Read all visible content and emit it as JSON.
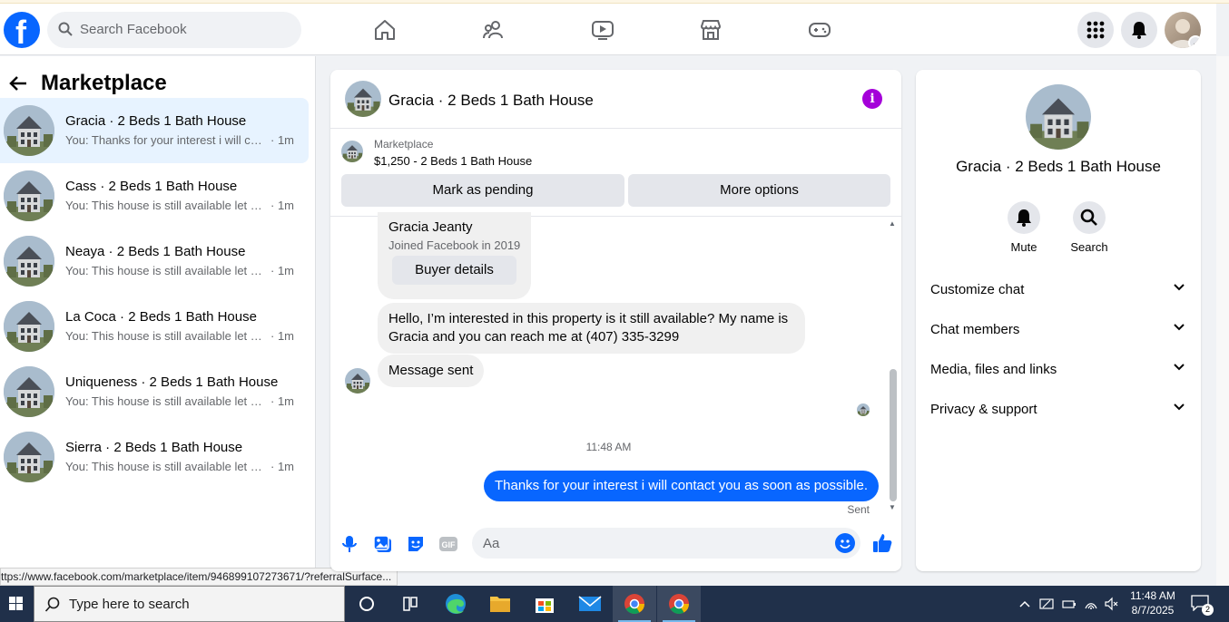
{
  "header": {
    "search_placeholder": "Search Facebook",
    "brand_color": "#0866ff",
    "nav_icons": [
      "home-icon",
      "friends-icon",
      "watch-icon",
      "marketplace-icon",
      "gaming-icon"
    ],
    "right_icons": [
      "menu-grid-icon",
      "notifications-bell-icon",
      "account-avatar"
    ]
  },
  "sidebar": {
    "title": "Marketplace",
    "conversations": [
      {
        "name": "Gracia · 2 Beds 1 Bath House",
        "preview": "You: Thanks for your interest i will contact you as soon as possible.",
        "time": "· 1m",
        "active": true
      },
      {
        "name": "Cass · 2 Beds 1 Bath House",
        "preview": "You: This house is still available let me know",
        "time": "· 1m"
      },
      {
        "name": "Neaya · 2 Beds 1 Bath House",
        "preview": "You: This house is still available let me know",
        "time": "· 1m"
      },
      {
        "name": "La Coca · 2 Beds 1 Bath House",
        "preview": "You: This house is still available let me know",
        "time": "· 1m"
      },
      {
        "name": "Uniqueness · 2 Beds 1 Bath House",
        "preview": "You: This house is still available let me know",
        "time": "· 1m"
      },
      {
        "name": "Sierra · 2 Beds 1 Bath House",
        "preview": "You: This house is still available let me know",
        "time": "· 1m"
      }
    ]
  },
  "status_url": "ttps://www.facebook.com/marketplace/item/946899107273671/?referralSurface...",
  "chat": {
    "title": "Gracia · 2 Beds 1 Bath House",
    "listing_label": "Marketplace",
    "listing_price": "$1,250 - 2 Beds 1 Bath House",
    "mark_pending": "Mark as pending",
    "more_options": "More options",
    "buyer_name": "Gracia Jeanty",
    "buyer_joined": "Joined Facebook in 2019",
    "buyer_details": "Buyer details",
    "incoming_message": "Hello, I’m interested in this property is it still available? My name is Gracia and you can reach me at (407) 335-3299",
    "message_sent": "Message sent",
    "timestamp": "11:48 AM",
    "outgoing_message": "Thanks for your interest i will contact you as soon as possible.",
    "sent_status": "Sent",
    "composer_placeholder": "Aa",
    "accent_purple": "#a400d9"
  },
  "details": {
    "name": "Gracia · 2 Beds 1 Bath House",
    "actions": [
      {
        "label": "Mute",
        "icon": "bell-icon"
      },
      {
        "label": "Search",
        "icon": "search-icon"
      }
    ],
    "sections": [
      "Customize chat",
      "Chat members",
      "Media, files and links",
      "Privacy & support"
    ]
  },
  "taskbar": {
    "search_placeholder": "Type here to search",
    "time": "11:48 AM",
    "date": "8/7/2025",
    "notification_count": "2",
    "apps": [
      "cortana-icon",
      "task-view-icon",
      "edge-icon",
      "file-explorer-icon",
      "store-icon",
      "mail-icon",
      "chrome-icon",
      "chrome-profile-icon"
    ]
  }
}
